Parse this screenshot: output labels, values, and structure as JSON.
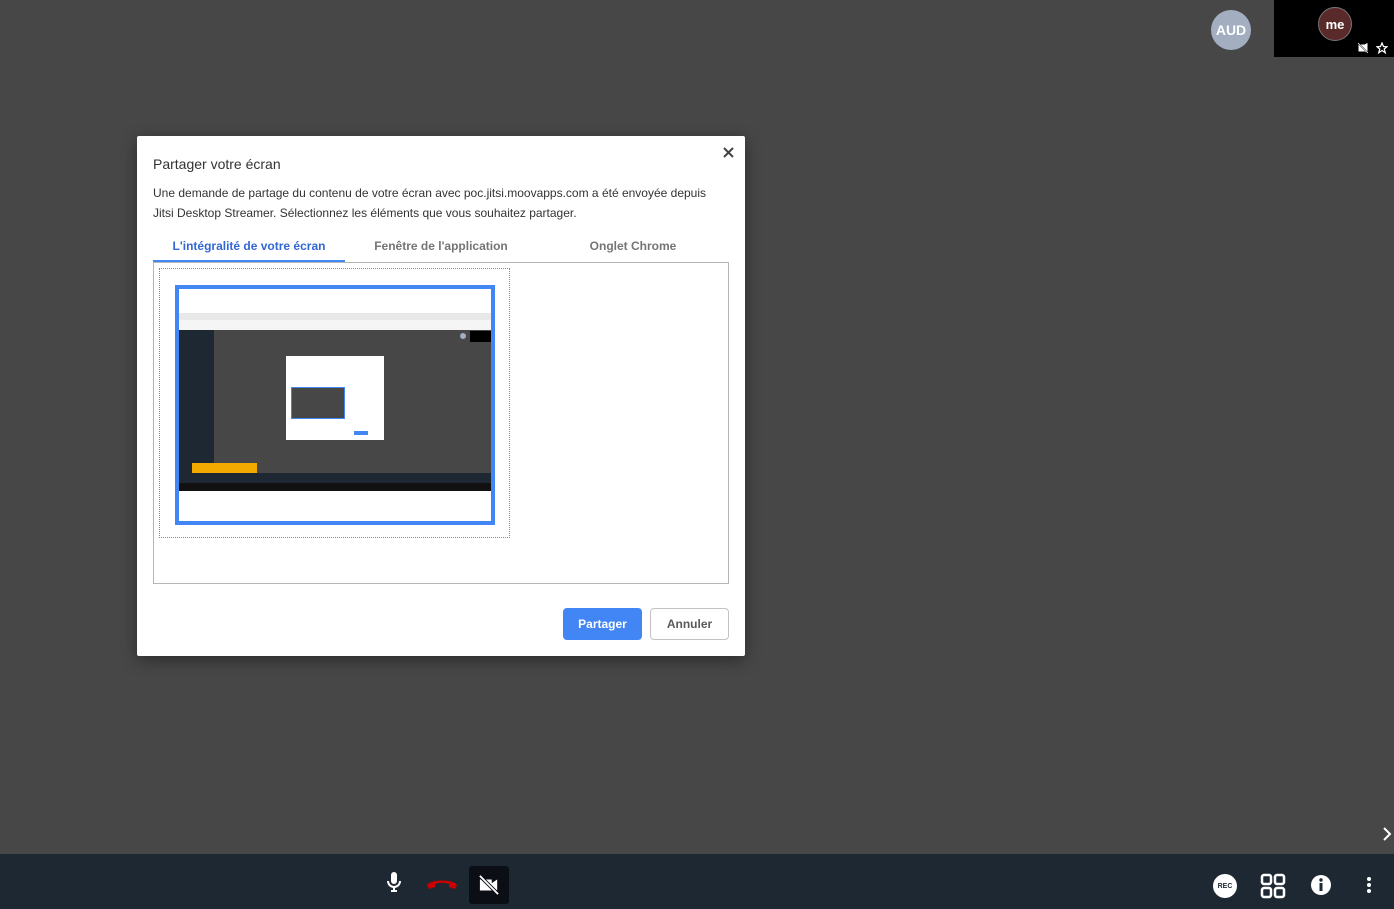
{
  "participants": {
    "remote_avatar_initials": "AUD",
    "self_avatar_label": "me"
  },
  "dialog": {
    "title": "Partager votre écran",
    "description": "Une demande de partage du contenu de votre écran avec poc.jitsi.moovapps.com a été envoyée depuis Jitsi Desktop Streamer. Sélectionnez les éléments que vous souhaitez partager.",
    "tabs": [
      {
        "label": "L'intégralité de votre écran",
        "active": true
      },
      {
        "label": "Fenêtre de l'application",
        "active": false
      },
      {
        "label": "Onglet Chrome",
        "active": false
      }
    ],
    "share_button_label": "Partager",
    "cancel_button_label": "Annuler"
  },
  "toolbar": {
    "rec_label": "REC"
  },
  "icons": {
    "close": "close-icon",
    "microphone": "microphone-icon",
    "hangup": "phone-hangup-icon",
    "camera_off": "camera-off-icon",
    "record": "record-icon",
    "tile_view": "tile-view-icon",
    "info": "info-icon",
    "more": "more-vertical-icon",
    "chevron": "chevron-right-icon"
  },
  "colors": {
    "background": "#474747",
    "toolbar": "#1e2833",
    "accent": "#4285f4",
    "hangup": "#cc0000",
    "avatar": "#a3aec0"
  }
}
